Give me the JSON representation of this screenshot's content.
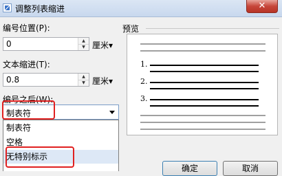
{
  "window": {
    "title": "调整列表缩进",
    "close_label": "✕"
  },
  "number_position": {
    "label": "编号位置(P):",
    "value": "0",
    "unit": "厘米▾"
  },
  "text_indent": {
    "label": "文本缩进(T):",
    "value": "0.8",
    "unit": "厘米▾"
  },
  "follow_number": {
    "label": "编号之后(W):",
    "selected": "制表符",
    "options": [
      "制表符",
      "空格",
      "无特别标示"
    ],
    "highlighted_option": "无特别标示"
  },
  "preview": {
    "label": "预览",
    "numbers": [
      "1.",
      "2.",
      "3."
    ]
  },
  "buttons": {
    "ok": "确定",
    "cancel": "取消"
  },
  "colors": {
    "highlight_box": "#e02020",
    "option_highlight": "#dde8f6"
  }
}
